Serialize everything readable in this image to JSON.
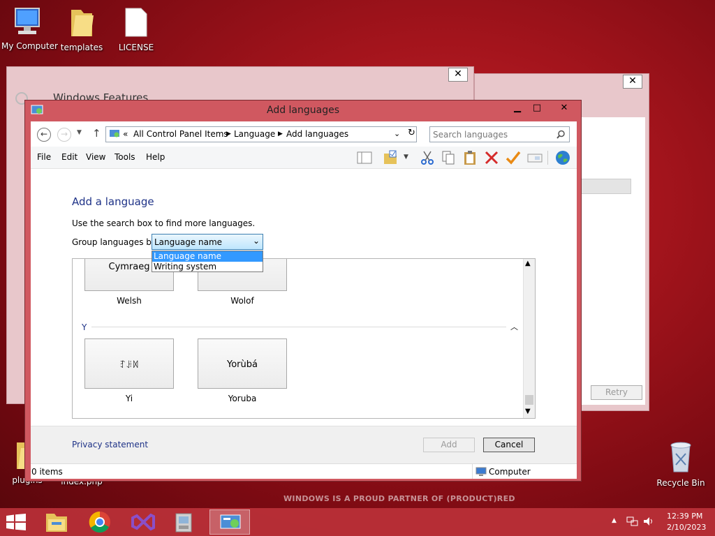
{
  "desktop": {
    "icons": [
      {
        "label": "My Computer"
      },
      {
        "label": "templates"
      },
      {
        "label": "LICENSE"
      },
      {
        "label": "plugins"
      },
      {
        "label": "index.php"
      },
      {
        "label": "Recycle Bin"
      }
    ],
    "watermark": "WINDOWS IS A PROUD PARTNER OF (PRODUCT)RED"
  },
  "bg_windows": {
    "features_title": "Windows Features",
    "retry_label": "Retry"
  },
  "window": {
    "title": "Add languages",
    "breadcrumb": {
      "prefix": "«",
      "items": [
        "All Control Panel Items",
        "Language",
        "Add languages"
      ]
    },
    "search_placeholder": "Search languages",
    "menu": [
      "File",
      "Edit",
      "View",
      "Tools",
      "Help"
    ],
    "heading": "Add a language",
    "instruction": "Use the search box to find more languages.",
    "group_by_label": "Group languages by:",
    "group_by_value": "Language name",
    "group_by_options": [
      "Language name",
      "Writing system"
    ],
    "section_letter": "Y",
    "languages": [
      {
        "native": "Cymraeg",
        "name": "Welsh"
      },
      {
        "native": "",
        "name": "Wolof"
      },
      {
        "native": "ꆈꌠꉙ",
        "name": "Yi"
      },
      {
        "native": "Yorùbá",
        "name": "Yoruba"
      }
    ],
    "privacy_link": "Privacy statement",
    "add_button": "Add",
    "cancel_button": "Cancel",
    "status_items": "0 items",
    "status_location": "Computer"
  },
  "tray": {
    "time": "12:39 PM",
    "date": "2/10/2023"
  },
  "colors": {
    "accent": "#d05860",
    "link": "#1e3287",
    "selection": "#3399ff"
  }
}
